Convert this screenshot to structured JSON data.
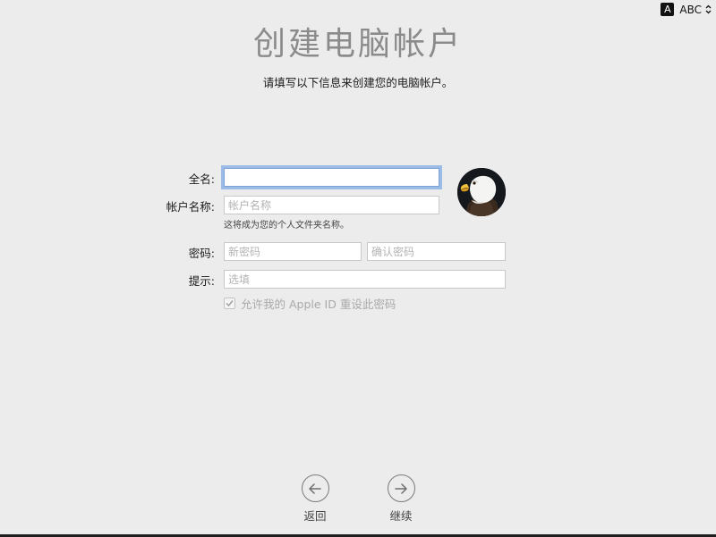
{
  "input_menu": {
    "badge": "A",
    "label": "ABC"
  },
  "header": {
    "title": "创建电脑帐户",
    "subtitle": "请填写以下信息来创建您的电脑帐户。"
  },
  "form": {
    "full_name": {
      "label": "全名:",
      "value": "",
      "placeholder": ""
    },
    "account_name": {
      "label": "帐户名称:",
      "value": "",
      "placeholder": "帐户名称",
      "hint": "这将成为您的个人文件夹名称。"
    },
    "password": {
      "label": "密码:",
      "value": "",
      "placeholder": "新密码"
    },
    "verify": {
      "value": "",
      "placeholder": "确认密码"
    },
    "hint": {
      "label": "提示:",
      "value": "",
      "placeholder": "选填"
    },
    "allow_reset": {
      "label": "允许我的 Apple ID 重设此密码",
      "checked": true
    }
  },
  "avatar": {
    "icon": "eagle-avatar"
  },
  "nav": {
    "back_label": "返回",
    "continue_label": "继续"
  }
}
